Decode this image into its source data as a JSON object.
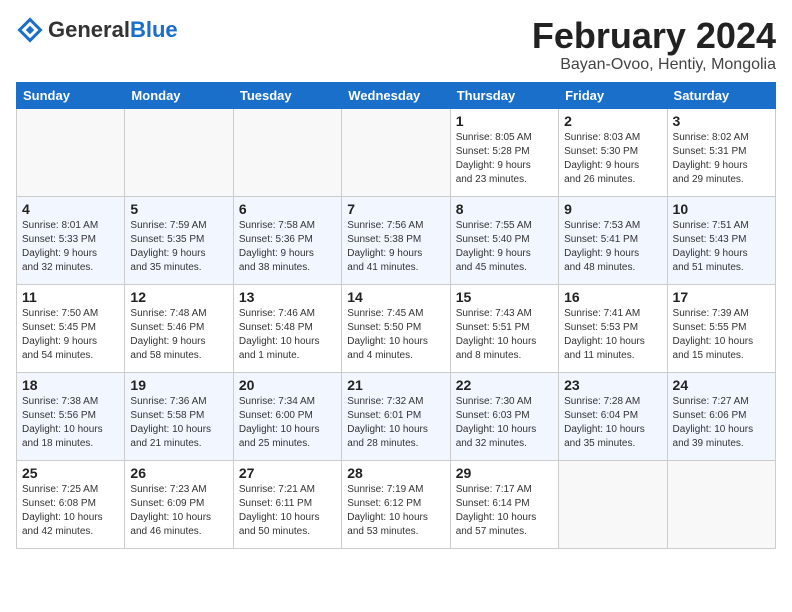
{
  "header": {
    "logo_general": "General",
    "logo_blue": "Blue",
    "month_title": "February 2024",
    "location": "Bayan-Ovoo, Hentiy, Mongolia"
  },
  "days_of_week": [
    "Sunday",
    "Monday",
    "Tuesday",
    "Wednesday",
    "Thursday",
    "Friday",
    "Saturday"
  ],
  "weeks": [
    [
      {
        "day": "",
        "info": ""
      },
      {
        "day": "",
        "info": ""
      },
      {
        "day": "",
        "info": ""
      },
      {
        "day": "",
        "info": ""
      },
      {
        "day": "1",
        "info": "Sunrise: 8:05 AM\nSunset: 5:28 PM\nDaylight: 9 hours\nand 23 minutes."
      },
      {
        "day": "2",
        "info": "Sunrise: 8:03 AM\nSunset: 5:30 PM\nDaylight: 9 hours\nand 26 minutes."
      },
      {
        "day": "3",
        "info": "Sunrise: 8:02 AM\nSunset: 5:31 PM\nDaylight: 9 hours\nand 29 minutes."
      }
    ],
    [
      {
        "day": "4",
        "info": "Sunrise: 8:01 AM\nSunset: 5:33 PM\nDaylight: 9 hours\nand 32 minutes."
      },
      {
        "day": "5",
        "info": "Sunrise: 7:59 AM\nSunset: 5:35 PM\nDaylight: 9 hours\nand 35 minutes."
      },
      {
        "day": "6",
        "info": "Sunrise: 7:58 AM\nSunset: 5:36 PM\nDaylight: 9 hours\nand 38 minutes."
      },
      {
        "day": "7",
        "info": "Sunrise: 7:56 AM\nSunset: 5:38 PM\nDaylight: 9 hours\nand 41 minutes."
      },
      {
        "day": "8",
        "info": "Sunrise: 7:55 AM\nSunset: 5:40 PM\nDaylight: 9 hours\nand 45 minutes."
      },
      {
        "day": "9",
        "info": "Sunrise: 7:53 AM\nSunset: 5:41 PM\nDaylight: 9 hours\nand 48 minutes."
      },
      {
        "day": "10",
        "info": "Sunrise: 7:51 AM\nSunset: 5:43 PM\nDaylight: 9 hours\nand 51 minutes."
      }
    ],
    [
      {
        "day": "11",
        "info": "Sunrise: 7:50 AM\nSunset: 5:45 PM\nDaylight: 9 hours\nand 54 minutes."
      },
      {
        "day": "12",
        "info": "Sunrise: 7:48 AM\nSunset: 5:46 PM\nDaylight: 9 hours\nand 58 minutes."
      },
      {
        "day": "13",
        "info": "Sunrise: 7:46 AM\nSunset: 5:48 PM\nDaylight: 10 hours\nand 1 minute."
      },
      {
        "day": "14",
        "info": "Sunrise: 7:45 AM\nSunset: 5:50 PM\nDaylight: 10 hours\nand 4 minutes."
      },
      {
        "day": "15",
        "info": "Sunrise: 7:43 AM\nSunset: 5:51 PM\nDaylight: 10 hours\nand 8 minutes."
      },
      {
        "day": "16",
        "info": "Sunrise: 7:41 AM\nSunset: 5:53 PM\nDaylight: 10 hours\nand 11 minutes."
      },
      {
        "day": "17",
        "info": "Sunrise: 7:39 AM\nSunset: 5:55 PM\nDaylight: 10 hours\nand 15 minutes."
      }
    ],
    [
      {
        "day": "18",
        "info": "Sunrise: 7:38 AM\nSunset: 5:56 PM\nDaylight: 10 hours\nand 18 minutes."
      },
      {
        "day": "19",
        "info": "Sunrise: 7:36 AM\nSunset: 5:58 PM\nDaylight: 10 hours\nand 21 minutes."
      },
      {
        "day": "20",
        "info": "Sunrise: 7:34 AM\nSunset: 6:00 PM\nDaylight: 10 hours\nand 25 minutes."
      },
      {
        "day": "21",
        "info": "Sunrise: 7:32 AM\nSunset: 6:01 PM\nDaylight: 10 hours\nand 28 minutes."
      },
      {
        "day": "22",
        "info": "Sunrise: 7:30 AM\nSunset: 6:03 PM\nDaylight: 10 hours\nand 32 minutes."
      },
      {
        "day": "23",
        "info": "Sunrise: 7:28 AM\nSunset: 6:04 PM\nDaylight: 10 hours\nand 35 minutes."
      },
      {
        "day": "24",
        "info": "Sunrise: 7:27 AM\nSunset: 6:06 PM\nDaylight: 10 hours\nand 39 minutes."
      }
    ],
    [
      {
        "day": "25",
        "info": "Sunrise: 7:25 AM\nSunset: 6:08 PM\nDaylight: 10 hours\nand 42 minutes."
      },
      {
        "day": "26",
        "info": "Sunrise: 7:23 AM\nSunset: 6:09 PM\nDaylight: 10 hours\nand 46 minutes."
      },
      {
        "day": "27",
        "info": "Sunrise: 7:21 AM\nSunset: 6:11 PM\nDaylight: 10 hours\nand 50 minutes."
      },
      {
        "day": "28",
        "info": "Sunrise: 7:19 AM\nSunset: 6:12 PM\nDaylight: 10 hours\nand 53 minutes."
      },
      {
        "day": "29",
        "info": "Sunrise: 7:17 AM\nSunset: 6:14 PM\nDaylight: 10 hours\nand 57 minutes."
      },
      {
        "day": "",
        "info": ""
      },
      {
        "day": "",
        "info": ""
      }
    ]
  ]
}
